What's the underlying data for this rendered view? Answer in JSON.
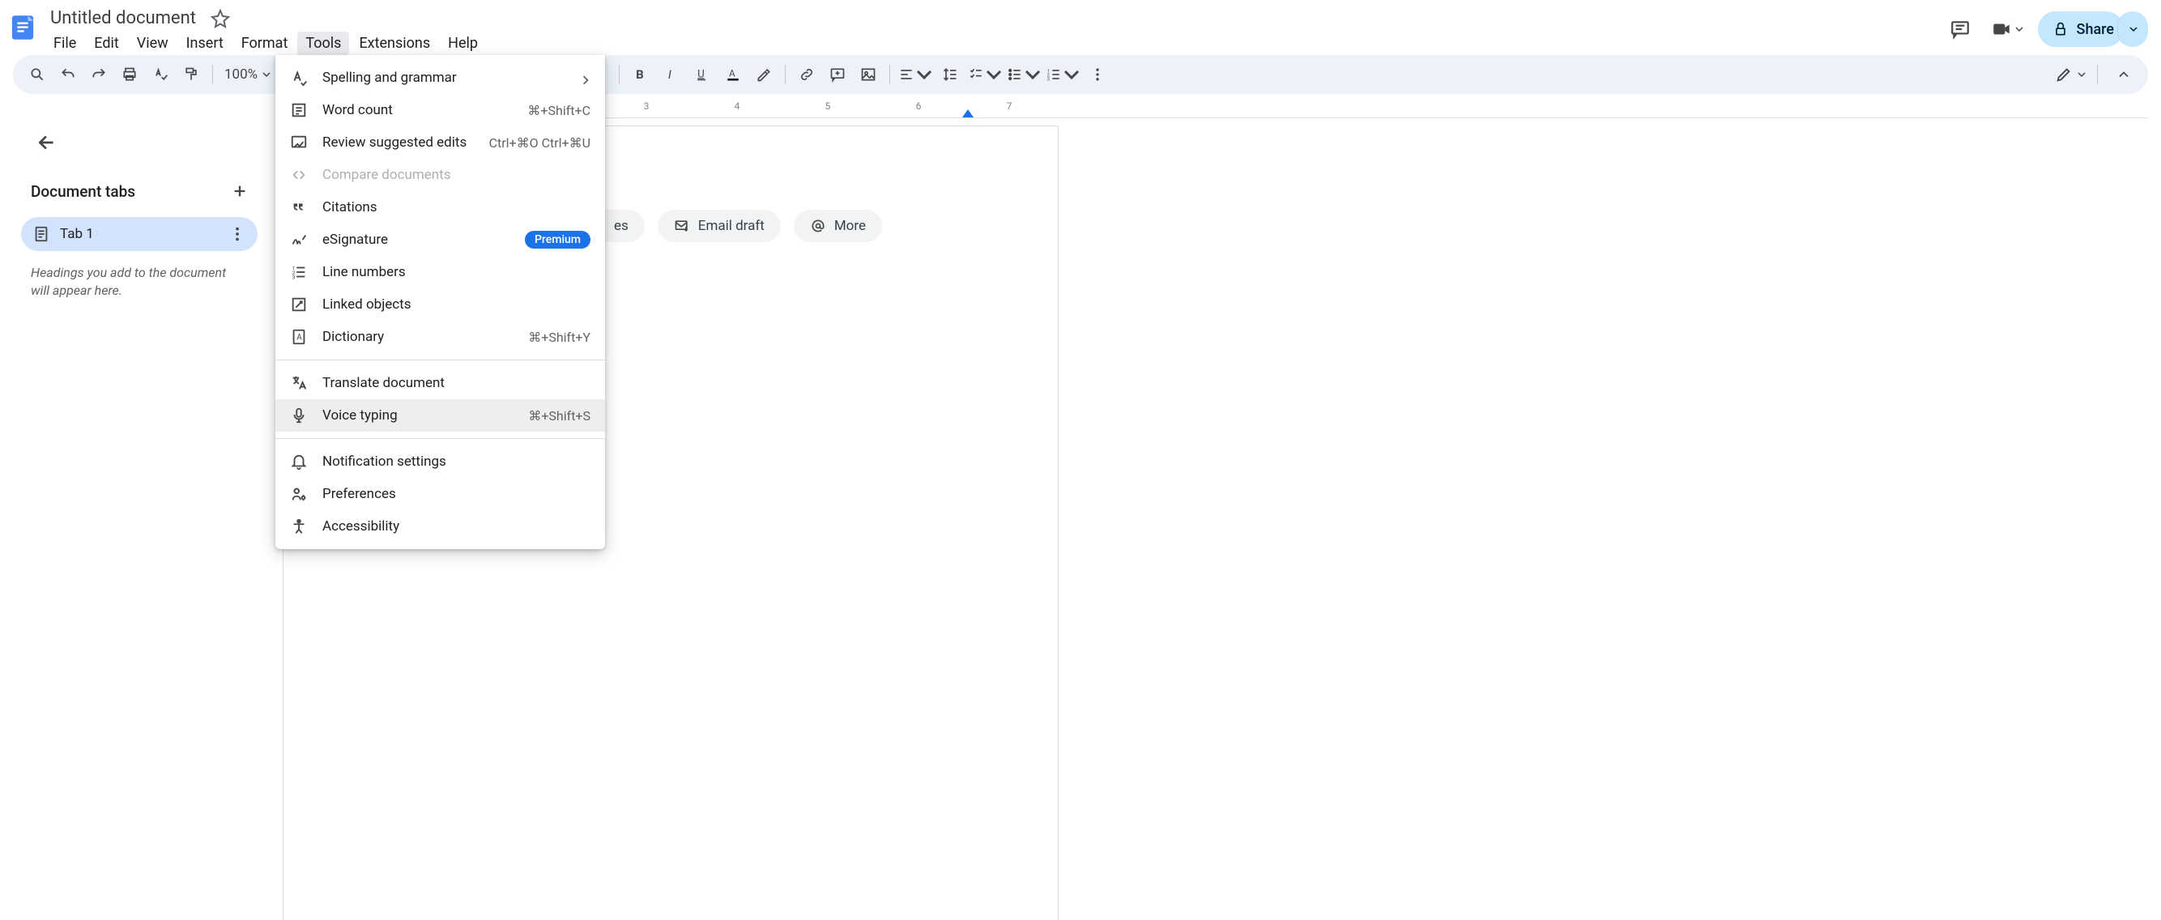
{
  "header": {
    "doc_title": "Untitled document",
    "share_label": "Share"
  },
  "menubar": [
    "File",
    "Edit",
    "View",
    "Insert",
    "Format",
    "Tools",
    "Extensions",
    "Help"
  ],
  "active_menu_index": 5,
  "zoom": "100%",
  "ruler_numbers": [
    "3",
    "4",
    "5",
    "6",
    "7"
  ],
  "sidebar": {
    "title": "Document tabs",
    "tab_label": "Tab 1",
    "hint": "Headings you add to the document will appear here."
  },
  "chips": {
    "notes_partial": "es",
    "email": "Email draft",
    "more": "More"
  },
  "tools_menu": [
    {
      "icon": "spell",
      "label": "Spelling and grammar",
      "submenu": true
    },
    {
      "icon": "wordcount",
      "label": "Word count",
      "shortcut": "⌘+Shift+C"
    },
    {
      "icon": "review",
      "label": "Review suggested edits",
      "shortcut": "Ctrl+⌘O Ctrl+⌘U"
    },
    {
      "icon": "compare",
      "label": "Compare documents",
      "disabled": true
    },
    {
      "icon": "cite",
      "label": "Citations"
    },
    {
      "icon": "esign",
      "label": "eSignature",
      "badge": "Premium"
    },
    {
      "icon": "linenum",
      "label": "Line numbers"
    },
    {
      "icon": "linked",
      "label": "Linked objects"
    },
    {
      "icon": "dict",
      "label": "Dictionary",
      "shortcut": "⌘+Shift+Y"
    },
    {
      "sep": true
    },
    {
      "icon": "translate",
      "label": "Translate document"
    },
    {
      "icon": "voice",
      "label": "Voice typing",
      "shortcut": "⌘+Shift+S",
      "hover": true
    },
    {
      "sep": true
    },
    {
      "icon": "bell",
      "label": "Notification settings"
    },
    {
      "icon": "prefs",
      "label": "Preferences"
    },
    {
      "icon": "a11y",
      "label": "Accessibility"
    }
  ]
}
